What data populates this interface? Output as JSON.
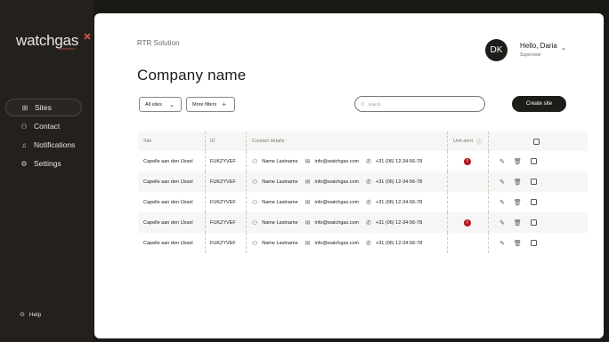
{
  "sidebar": {
    "logo": "watchgas",
    "logo_sub": "detection",
    "items": [
      {
        "label": "Sites",
        "icon": "grid-icon",
        "active": true
      },
      {
        "label": "Contact",
        "icon": "user-icon",
        "active": false
      },
      {
        "label": "Notifications",
        "icon": "bell-icon",
        "active": false
      },
      {
        "label": "Settings",
        "icon": "gear-icon",
        "active": false
      }
    ],
    "help_label": "Help"
  },
  "header": {
    "breadcrumb": "RTR Solution",
    "title": "Company name",
    "user": {
      "initials": "DK",
      "greeting": "Hello, Daria",
      "role": "Supervisor"
    }
  },
  "toolbar": {
    "all_sites_label": "All sites",
    "more_filters_label": "More filters",
    "search_placeholder": "Search",
    "create_label": "Create site"
  },
  "table": {
    "headers": {
      "site": "Site",
      "id": "ID",
      "contact": "Contact details",
      "unit_alert": "Unit alert"
    },
    "rows": [
      {
        "site": "Capelle aan den IJssel",
        "id": "FUKZYVEF",
        "name": "Name Lastname",
        "email": "info@watchgas.com",
        "phone": "+31 (06) 12-34-56-78",
        "alert": true
      },
      {
        "site": "Capelle aan den IJssel",
        "id": "FUKZYVEF",
        "name": "Name Lastname",
        "email": "info@watchgas.com",
        "phone": "+31 (06) 12-34-56-78",
        "alert": false
      },
      {
        "site": "Capelle aan den IJssel",
        "id": "FUKZYVEF",
        "name": "Name Lastname",
        "email": "info@watchgas.com",
        "phone": "+31 (06) 12-34-56-78",
        "alert": false
      },
      {
        "site": "Capelle aan den IJssel",
        "id": "FUKZYVEF",
        "name": "Name Lastname",
        "email": "info@watchgas.com",
        "phone": "+31 (06) 12-34-56-78",
        "alert": true
      },
      {
        "site": "Capelle aan den IJssel",
        "id": "FUKZYVEF",
        "name": "Name Lastname",
        "email": "info@watchgas.com",
        "phone": "+31 (06) 12-34-56-78",
        "alert": false
      }
    ]
  },
  "colors": {
    "accent_dark": "#1f1d1a",
    "alert": "#b3141b",
    "sidebar_bg": "#24211d"
  }
}
